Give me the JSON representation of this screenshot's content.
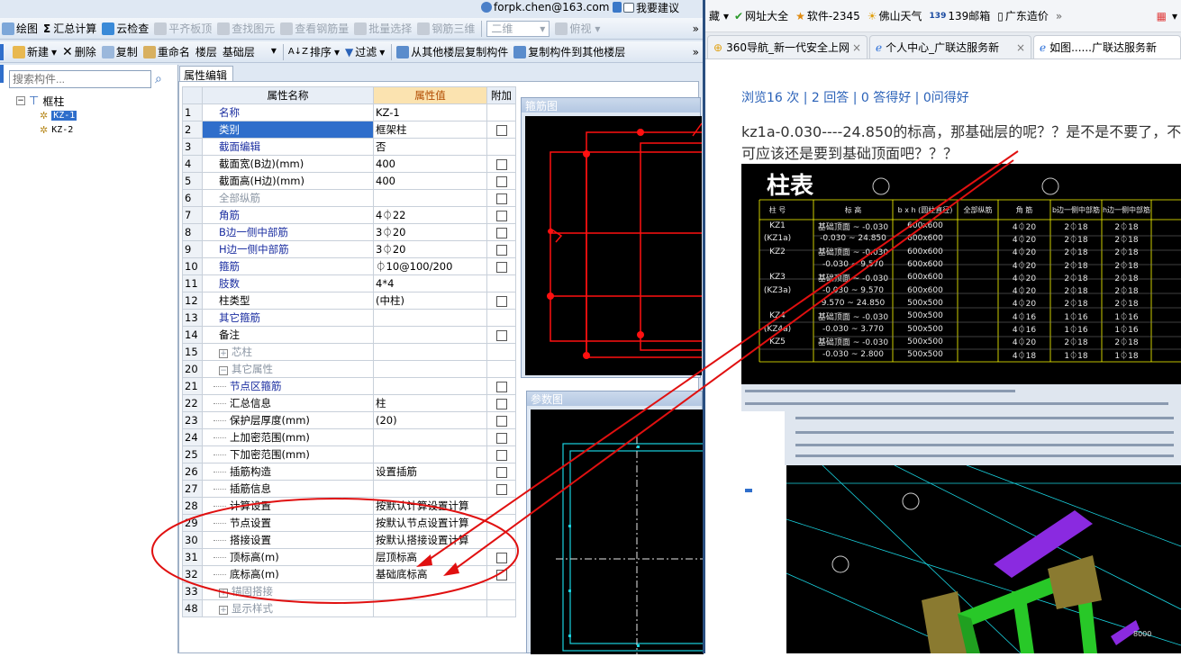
{
  "app": {
    "top_user": "forpk.chen@163.com",
    "top_suggest": "我要建议",
    "toolbar1": [
      "绘图",
      "汇总计算",
      "云检查",
      "平齐板顶",
      "查找图元",
      "查看钢筋量",
      "批量选择",
      "钢筋三维"
    ],
    "toolbar1_view": [
      "二维",
      "俯视"
    ],
    "toolbar2": [
      "新建",
      "删除",
      "复制",
      "重命名",
      "楼层",
      "基础层",
      "排序",
      "过滤",
      "从其他楼层复制构件",
      "复制构件到其他楼层"
    ],
    "search_placeholder": "搜索构件...",
    "tree": {
      "root": "框柱",
      "items": [
        "KZ-1",
        "KZ-2"
      ]
    },
    "tab": "属性编辑",
    "table_headers": {
      "name": "属性名称",
      "value": "属性值",
      "extra": "附加"
    },
    "rows": [
      {
        "n": "1",
        "name": "名称",
        "value": "KZ-1",
        "cb": false,
        "style": "blue"
      },
      {
        "n": "2",
        "name": "类别",
        "value": "框架柱",
        "cb": true,
        "style": "sel"
      },
      {
        "n": "3",
        "name": "截面编辑",
        "value": "否",
        "cb": false,
        "style": "blue"
      },
      {
        "n": "4",
        "name": "截面宽(B边)(mm)",
        "value": "400",
        "cb": true,
        "style": ""
      },
      {
        "n": "5",
        "name": "截面高(H边)(mm)",
        "value": "400",
        "cb": true,
        "style": ""
      },
      {
        "n": "6",
        "name": "全部纵筋",
        "value": "",
        "cb": true,
        "style": "gray"
      },
      {
        "n": "7",
        "name": "角筋",
        "value": "4⏀22",
        "cb": true,
        "style": "blue"
      },
      {
        "n": "8",
        "name": "B边一侧中部筋",
        "value": "3⏀20",
        "cb": true,
        "style": "blue"
      },
      {
        "n": "9",
        "name": "H边一侧中部筋",
        "value": "3⏀20",
        "cb": true,
        "style": "blue"
      },
      {
        "n": "10",
        "name": "箍筋",
        "value": "⏀10@100/200",
        "cb": true,
        "style": "blue"
      },
      {
        "n": "11",
        "name": "肢数",
        "value": "4*4",
        "cb": false,
        "style": "blue"
      },
      {
        "n": "12",
        "name": "柱类型",
        "value": "(中柱)",
        "cb": true,
        "style": ""
      },
      {
        "n": "13",
        "name": "其它箍筋",
        "value": "",
        "cb": false,
        "style": "blue"
      },
      {
        "n": "14",
        "name": "备注",
        "value": "",
        "cb": true,
        "style": ""
      },
      {
        "n": "15",
        "name": "芯柱",
        "value": "",
        "cb": false,
        "style": "gray",
        "expand": "+"
      },
      {
        "n": "20",
        "name": "其它属性",
        "value": "",
        "cb": false,
        "style": "gray",
        "expand": "−"
      },
      {
        "n": "21",
        "name": "节点区箍筋",
        "value": "",
        "cb": true,
        "style": "blue tree"
      },
      {
        "n": "22",
        "name": "汇总信息",
        "value": "柱",
        "cb": true,
        "style": "tree"
      },
      {
        "n": "23",
        "name": "保护层厚度(mm)",
        "value": "(20)",
        "cb": true,
        "style": "tree"
      },
      {
        "n": "24",
        "name": "上加密范围(mm)",
        "value": "",
        "cb": true,
        "style": "tree"
      },
      {
        "n": "25",
        "name": "下加密范围(mm)",
        "value": "",
        "cb": true,
        "style": "tree"
      },
      {
        "n": "26",
        "name": "插筋构造",
        "value": "设置插筋",
        "cb": true,
        "style": "tree"
      },
      {
        "n": "27",
        "name": "插筋信息",
        "value": "",
        "cb": true,
        "style": "tree"
      },
      {
        "n": "28",
        "name": "计算设置",
        "value": "按默认计算设置计算",
        "cb": false,
        "style": "tree"
      },
      {
        "n": "29",
        "name": "节点设置",
        "value": "按默认节点设置计算",
        "cb": false,
        "style": "tree"
      },
      {
        "n": "30",
        "name": "搭接设置",
        "value": "按默认搭接设置计算",
        "cb": false,
        "style": "tree"
      },
      {
        "n": "31",
        "name": "顶标高(m)",
        "value": "层顶标高",
        "cb": true,
        "style": "tree"
      },
      {
        "n": "32",
        "name": "底标高(m)",
        "value": "基础底标高",
        "cb": true,
        "style": "tree"
      },
      {
        "n": "33",
        "name": "锚固搭接",
        "value": "",
        "cb": false,
        "style": "gray",
        "expand": "+"
      },
      {
        "n": "48",
        "name": "显示样式",
        "value": "",
        "cb": false,
        "style": "gray",
        "expand": "+"
      }
    ],
    "panel_rebar": "箍筋图",
    "panel_param": "参数图"
  },
  "browser": {
    "bookmarks": [
      "网址大全",
      "软件-2345",
      "佛山天气",
      "139邮箱",
      "广东造价"
    ],
    "tabs": [
      "360导航_新一代安全上网",
      "个人中心_广联达服务新",
      "如图......广联达服务新"
    ],
    "stats": "浏览16 次 | 2 回答 | 0 答得好 | 0问得好",
    "question": "kz1a-0.030----24.850的标高，那基础层的呢？？是不是不要了，不可应该还是要到基础顶面吧？？？",
    "cad_title": "柱表",
    "cad_headers": [
      "柱 号",
      "标 高",
      "b x h (圆柱直径)",
      "全部纵筋",
      "角 筋",
      "b边一侧中部筋",
      "h边一侧中部筋"
    ],
    "cad_rows": [
      [
        "KZ1",
        "基础顶面 ~ -0.030",
        "600x600",
        "",
        "4⏀20",
        "2⏀18",
        "2⏀18"
      ],
      [
        "(KZ1a)",
        "-0.030 ~ 24.850",
        "600x600",
        "",
        "4⏀20",
        "2⏀18",
        "2⏀18"
      ],
      [
        "KZ2",
        "基础顶面 ~ -0.030",
        "600x600",
        "",
        "4⏀20",
        "2⏀18",
        "2⏀18"
      ],
      [
        "",
        "-0.030 ~ 9.570",
        "600x600",
        "",
        "4⏀20",
        "2⏀18",
        "2⏀18"
      ],
      [
        "KZ3",
        "基础顶面 ~ -0.030",
        "600x600",
        "",
        "4⏀20",
        "2⏀18",
        "2⏀18"
      ],
      [
        "(KZ3a)",
        "-0.030 ~ 9.570",
        "600x600",
        "",
        "4⏀20",
        "2⏀18",
        "2⏀18"
      ],
      [
        "",
        "9.570 ~ 24.850",
        "500x500",
        "",
        "4⏀20",
        "2⏀18",
        "2⏀18"
      ],
      [
        "KZ4",
        "基础顶面 ~ -0.030",
        "500x500",
        "",
        "4⏀16",
        "1⏀16",
        "1⏀16"
      ],
      [
        "(KZ4a)",
        "-0.030 ~ 3.770",
        "500x500",
        "",
        "4⏀16",
        "1⏀16",
        "1⏀16"
      ],
      [
        "KZ5",
        "基础顶面 ~ -0.030",
        "500x500",
        "",
        "4⏀20",
        "2⏀18",
        "2⏀18"
      ],
      [
        "",
        "-0.030 ~ 2.800",
        "500x500",
        "",
        "4⏀18",
        "1⏀18",
        "1⏀18"
      ]
    ]
  }
}
